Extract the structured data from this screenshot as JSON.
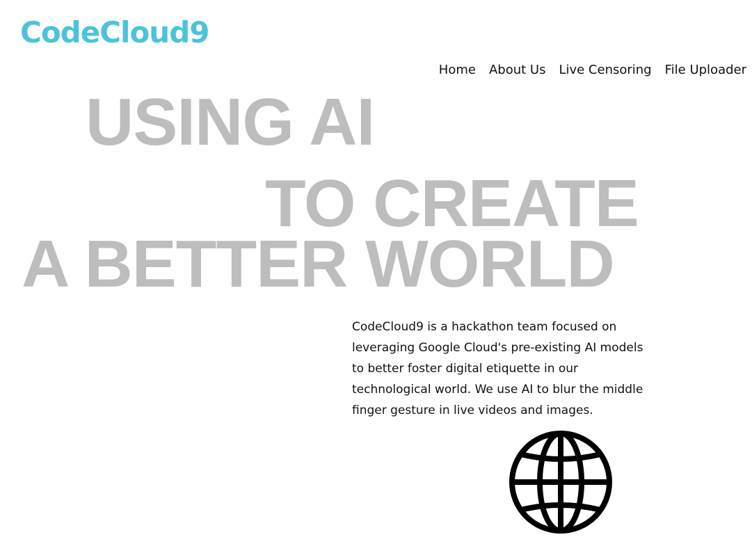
{
  "header": {
    "logo": "CodeCloud9",
    "brand_color": "#4bc3dc"
  },
  "nav": {
    "items": [
      {
        "label": "Home"
      },
      {
        "label": "About Us"
      },
      {
        "label": "Live Censoring"
      },
      {
        "label": "File Uploader"
      }
    ]
  },
  "hero": {
    "line1": "USING AI",
    "line2": "TO CREATE",
    "line3": "A BETTER WORLD",
    "color": "#bdbdbd"
  },
  "description": {
    "text": "CodeCloud9 is a hackathon team focused on leveraging Google Cloud's pre-existing AI models to better foster digital etiquette in our technological world. We use AI to blur the middle finger gesture in live videos and images."
  },
  "icons": {
    "globe": "globe-icon"
  }
}
